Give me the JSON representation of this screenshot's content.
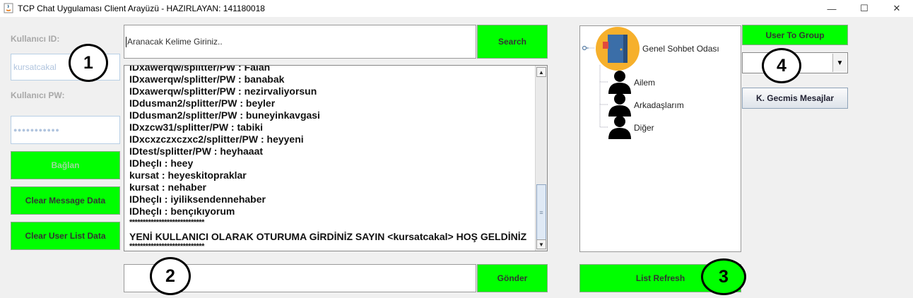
{
  "window": {
    "title": "TCP Chat Uygulaması Client Arayüzü - HAZIRLAYAN: 141180018",
    "controls": {
      "minimize": "—",
      "maximize": "☐",
      "close": "✕"
    }
  },
  "login": {
    "user_id_label": "Kullanıcı ID:",
    "user_id_value": "kursatcakal",
    "password_label": "Kullanıcı PW:",
    "password_value": "●●●●●●●●●●●",
    "connect_label": "Bağlan"
  },
  "buttons": {
    "clear_message": "Clear Message Data",
    "clear_user_list": "Clear User List Data",
    "search": "Search",
    "send": "Gönder",
    "list_refresh": "List Refresh",
    "user_to_group": "User To Group",
    "past_messages": "K. Gecmis Mesajlar"
  },
  "search": {
    "value": "Aranacak Kelime Giriniz.."
  },
  "messages": {
    "partial_top": "IDxawerqw/splitter/PW : Falan",
    "lines": [
      "IDxawerqw/splitter/PW : banabak",
      "IDxawerqw/splitter/PW : nezirvaliyorsun",
      "IDdusman2/splitter/PW : beyler",
      "IDdusman2/splitter/PW : buneyinkavgasi",
      "IDxzcw31/splitter/PW : tabiki",
      "IDxcxzczxczxc2/splitter/PW : heyyeni",
      "IDtest/splitter/PW : heyhaaat",
      "IDheçlı : heey",
      "kursat : heyeskitopraklar",
      "kursat : nehaber",
      "IDheçlı : iyiliksendennehaber",
      "IDheçlı : bençıkıyorum"
    ],
    "separator": "****************************",
    "welcome": "YENİ KULLANICI OLARAK OTURUMA GİRDİNİZ SAYIN  <kursatcakal>  HOŞ GELDİNİZ"
  },
  "tree": {
    "root": "Genel Sohbet Odası",
    "children": [
      "Ailem",
      "Arkadaşlarım",
      "Diğer"
    ]
  },
  "combo": {
    "selected": ""
  },
  "annotations": [
    "1",
    "2",
    "3",
    "4"
  ],
  "colors": {
    "button_green": "#00ff00",
    "field_border": "#b8cfe5",
    "background": "#f0f0f0"
  }
}
